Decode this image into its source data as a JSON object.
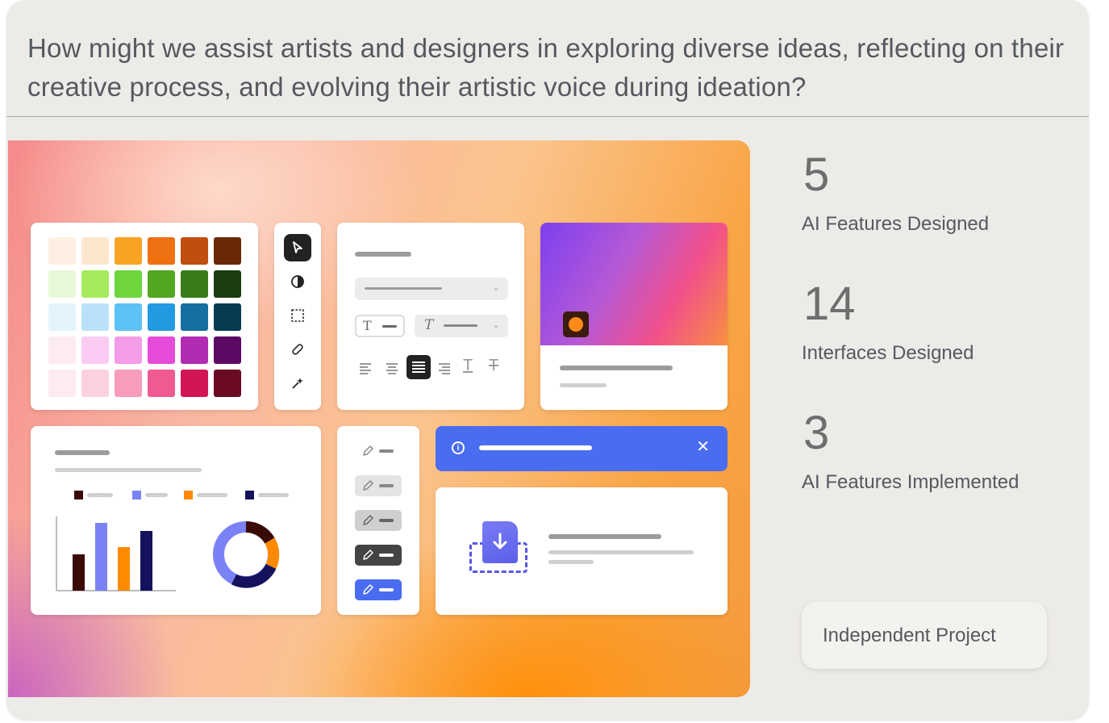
{
  "question": "How might we assist artists and designers in exploring diverse ideas, reflecting on their creative process, and evolving their artistic voice during ideation?",
  "stats": [
    {
      "value": "5",
      "label": "AI Features Designed"
    },
    {
      "value": "14",
      "label": "Interfaces Designed"
    },
    {
      "value": "3",
      "label": "AI Features Implemented"
    }
  ],
  "project_tag": "Independent Project",
  "palette_colors": [
    [
      "#fdf0e2",
      "#fde6ce",
      "#f9a324",
      "#ee7010",
      "#c04e0e",
      "#6a2806"
    ],
    [
      "#e6f8d8",
      "#a5eb5c",
      "#6ed53c",
      "#53a61f",
      "#387d1a",
      "#1b3d0f"
    ],
    [
      "#e3f4fd",
      "#b9e2fa",
      "#5cc1f3",
      "#2399e2",
      "#166fa1",
      "#083a52"
    ],
    [
      "#fdebf4",
      "#fbcbf4",
      "#f59ce8",
      "#e64ad8",
      "#b22bb3",
      "#5b0a63"
    ],
    [
      "#fdebef",
      "#fbd1dd",
      "#f79cba",
      "#ef5a92",
      "#d31556",
      "#6a0b23"
    ]
  ],
  "brand_colors": {
    "accent_blue": "#4a6cf0",
    "navy": "#14125c",
    "orange": "#ff8a00"
  }
}
